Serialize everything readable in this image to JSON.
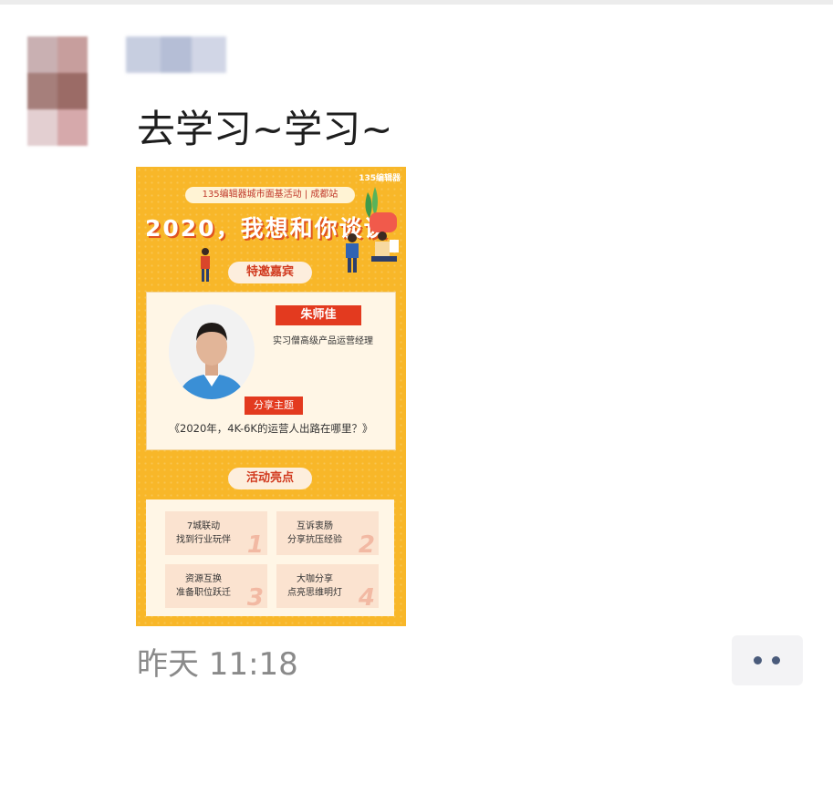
{
  "post": {
    "text": "去学习~学习~",
    "timestamp": "昨天 11:18"
  },
  "poster": {
    "logo": "135编辑器",
    "banner": "135编辑器城市面基活动 | 成都站",
    "headline": "2020，我想和你谈谈",
    "guest_section": "特邀嘉宾",
    "guest_name": "朱师佳",
    "guest_title": "实习僧高级产品运营经理",
    "topic_label": "分享主题",
    "topic": "《2020年，4K-6K的运营人出路在哪里？》",
    "highlights_section": "活动亮点",
    "highlights": [
      {
        "line1": "7城联动",
        "line2": "找到行业玩伴",
        "num": "1"
      },
      {
        "line1": "互诉衷肠",
        "line2": "分享抗压经验",
        "num": "2"
      },
      {
        "line1": "资源互换",
        "line2": "准备职位跃迁",
        "num": "3"
      },
      {
        "line1": "大咖分享",
        "line2": "点亮思维明灯",
        "num": "4"
      }
    ]
  },
  "actions": {
    "more_icon": "more-dots-icon"
  },
  "colors": {
    "poster_bg": "#f8b729",
    "accent_red": "#e33a1f",
    "more_dots": "#4a5b7b"
  }
}
